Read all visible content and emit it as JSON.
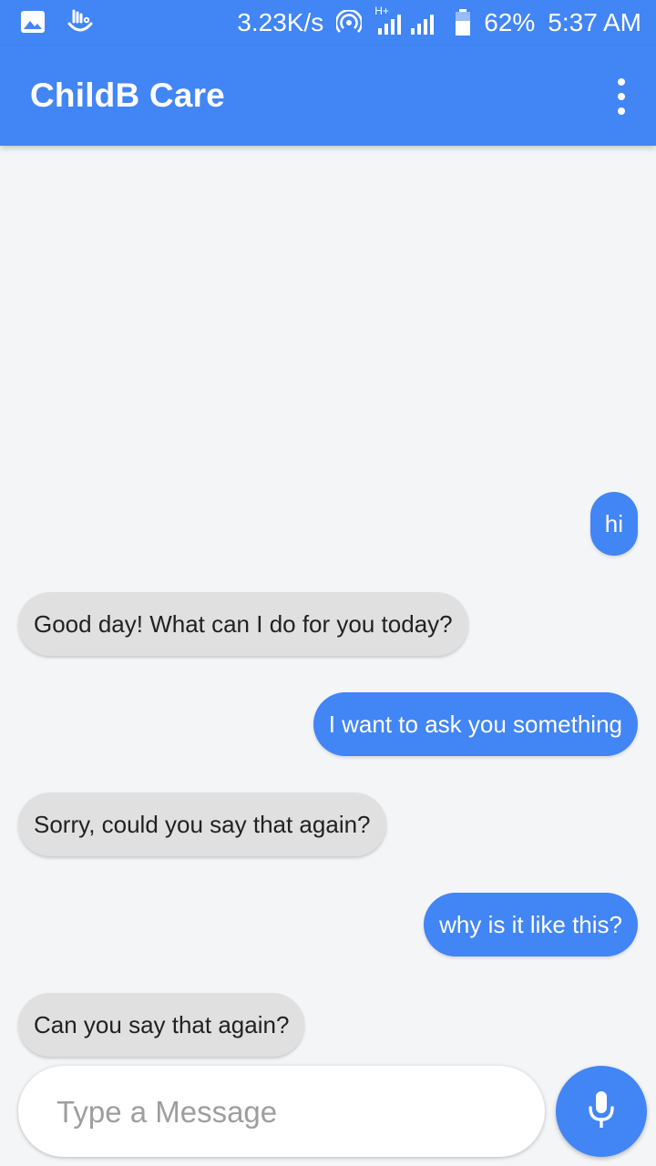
{
  "status_bar": {
    "left_icons": [
      "image-icon",
      "touchpal-icon"
    ],
    "speed": "3.23K/s",
    "network_label": "H+",
    "battery_percent": "62%",
    "time": "5:37 AM"
  },
  "app_bar": {
    "title": "ChildB Care",
    "menu_icon": "more-vert-icon"
  },
  "messages": [
    {
      "sender": "user",
      "text": "hi"
    },
    {
      "sender": "bot",
      "text": "Good day! What can I do for you today?"
    },
    {
      "sender": "user",
      "text": "I want to ask you something"
    },
    {
      "sender": "bot",
      "text": "Sorry, could you say that again?"
    },
    {
      "sender": "user",
      "text": "why is it like this?"
    },
    {
      "sender": "bot",
      "text": "Can you say that again?"
    }
  ],
  "composer": {
    "placeholder": "Type a Message",
    "value": "",
    "mic_icon": "mic-icon"
  },
  "colors": {
    "primary": "#4285f4",
    "bot_bubble": "#e0e0e0",
    "background": "#f4f5f7"
  }
}
